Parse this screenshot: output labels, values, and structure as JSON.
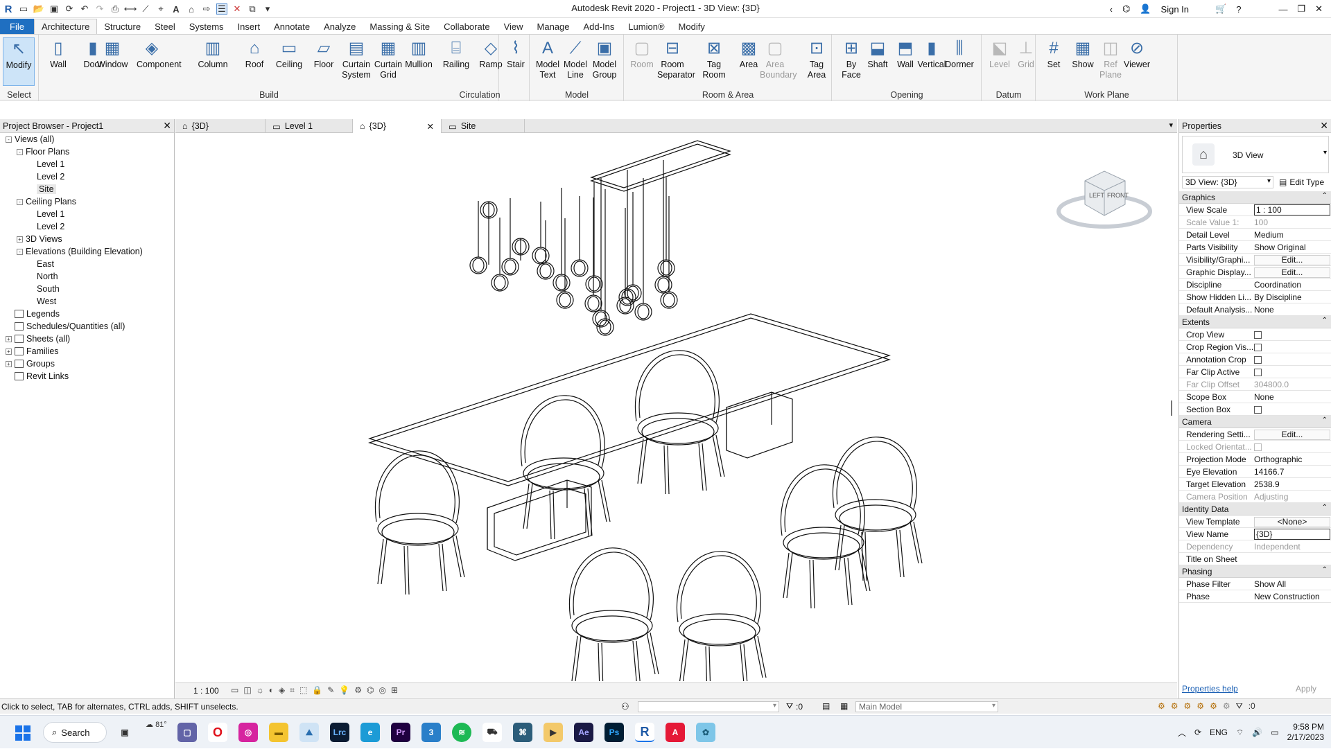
{
  "window": {
    "title": "Autodesk Revit 2020 - Project1 - 3D View: {3D}",
    "sign_in": "Sign In"
  },
  "menu": [
    "File",
    "Architecture",
    "Structure",
    "Steel",
    "Systems",
    "Insert",
    "Annotate",
    "Analyze",
    "Massing & Site",
    "Collaborate",
    "View",
    "Manage",
    "Add-Ins",
    "Lumion®",
    "Modify"
  ],
  "ribbon": {
    "select_label": "Select",
    "select_tools": [
      {
        "label": "Modify"
      }
    ],
    "build_label": "Build",
    "build_tools": [
      {
        "label": "Wall"
      },
      {
        "label": "Door"
      },
      {
        "label": "Window"
      },
      {
        "label": "Component"
      },
      {
        "label": "Column"
      },
      {
        "label": "Roof"
      },
      {
        "label": "Ceiling"
      },
      {
        "label": "Floor"
      },
      {
        "label": "Curtain\nSystem"
      },
      {
        "label": "Curtain\nGrid"
      },
      {
        "label": "Mullion"
      }
    ],
    "circulation_label": "Circulation",
    "circulation_tools": [
      {
        "label": "Railing"
      },
      {
        "label": "Ramp"
      },
      {
        "label": "Stair"
      }
    ],
    "model_label": "Model",
    "model_tools": [
      {
        "label": "Model\nText"
      },
      {
        "label": "Model\nLine"
      },
      {
        "label": "Model\nGroup"
      }
    ],
    "room_label": "Room & Area",
    "room_tools": [
      {
        "label": "Room",
        "disabled": true
      },
      {
        "label": "Room\nSeparator"
      },
      {
        "label": "Tag\nRoom"
      },
      {
        "label": "Area"
      },
      {
        "label": "Area\nBoundary",
        "disabled": true
      },
      {
        "label": "Tag\nArea"
      }
    ],
    "opening_label": "Opening",
    "opening_tools": [
      {
        "label": "By\nFace"
      },
      {
        "label": "Shaft"
      },
      {
        "label": "Wall"
      },
      {
        "label": "Vertical"
      },
      {
        "label": "Dormer"
      }
    ],
    "datum_label": "Datum",
    "datum_tools": [
      {
        "label": "Level",
        "disabled": true
      },
      {
        "label": "Grid",
        "disabled": true
      }
    ],
    "workplane_label": "Work Plane",
    "workplane_tools": [
      {
        "label": "Set"
      },
      {
        "label": "Show"
      },
      {
        "label": "Ref\nPlane",
        "disabled": true
      },
      {
        "label": "Viewer"
      }
    ]
  },
  "browser": {
    "title": "Project Browser - Project1",
    "nodes": [
      {
        "label": "Views (all)",
        "level": 0,
        "exp": "-"
      },
      {
        "label": "Floor Plans",
        "level": 1,
        "exp": "-"
      },
      {
        "label": "Level 1",
        "level": 2
      },
      {
        "label": "Level 2",
        "level": 2
      },
      {
        "label": "Site",
        "level": 2,
        "selected": true
      },
      {
        "label": "Ceiling Plans",
        "level": 1,
        "exp": "-"
      },
      {
        "label": "Level 1",
        "level": 2
      },
      {
        "label": "Level 2",
        "level": 2
      },
      {
        "label": "3D Views",
        "level": 1,
        "exp": "+"
      },
      {
        "label": "Elevations (Building Elevation)",
        "level": 1,
        "exp": "-"
      },
      {
        "label": "East",
        "level": 2
      },
      {
        "label": "North",
        "level": 2
      },
      {
        "label": "South",
        "level": 2
      },
      {
        "label": "West",
        "level": 2
      },
      {
        "label": "Legends",
        "level": 0,
        "icon": true
      },
      {
        "label": "Schedules/Quantities (all)",
        "level": 0,
        "icon": true
      },
      {
        "label": "Sheets (all)",
        "level": 0,
        "exp": "+",
        "icon": true
      },
      {
        "label": "Families",
        "level": 0,
        "exp": "+",
        "icon": true
      },
      {
        "label": "Groups",
        "level": 0,
        "exp": "+",
        "icon": true
      },
      {
        "label": "Revit Links",
        "level": 0,
        "icon": true
      }
    ]
  },
  "tabs": [
    {
      "label": "{3D}",
      "active": false
    },
    {
      "label": "Level 1",
      "active": false
    },
    {
      "label": "{3D}",
      "active": true
    },
    {
      "label": "Site",
      "active": false
    }
  ],
  "viewcube": {
    "left": "LEFT",
    "front": "FRONT"
  },
  "viewbar": {
    "scale": "1 : 100"
  },
  "properties": {
    "title": "Properties",
    "type_name": "3D View",
    "selector": "3D View: {3D}",
    "edit_type": "Edit Type",
    "help": "Properties help",
    "apply": "Apply",
    "sections": [
      {
        "name": "Graphics",
        "rows": [
          {
            "k": "View Scale",
            "v": "1 : 100",
            "input": true
          },
          {
            "k": "Scale Value    1:",
            "v": "100",
            "dis": true
          },
          {
            "k": "Detail Level",
            "v": "Medium"
          },
          {
            "k": "Parts Visibility",
            "v": "Show Original"
          },
          {
            "k": "Visibility/Graphi...",
            "v": "Edit...",
            "btn": true
          },
          {
            "k": "Graphic Display...",
            "v": "Edit...",
            "btn": true
          },
          {
            "k": "Discipline",
            "v": "Coordination"
          },
          {
            "k": "Show Hidden Li...",
            "v": "By Discipline"
          },
          {
            "k": "Default Analysis...",
            "v": "None"
          }
        ]
      },
      {
        "name": "Extents",
        "rows": [
          {
            "k": "Crop View",
            "v": "",
            "chk": true
          },
          {
            "k": "Crop Region Vis...",
            "v": "",
            "chk": true
          },
          {
            "k": "Annotation Crop",
            "v": "",
            "chk": true
          },
          {
            "k": "Far Clip Active",
            "v": "",
            "chk": true
          },
          {
            "k": "Far Clip Offset",
            "v": "304800.0",
            "dis": true
          },
          {
            "k": "Scope Box",
            "v": "None"
          },
          {
            "k": "Section Box",
            "v": "",
            "chk": true
          }
        ]
      },
      {
        "name": "Camera",
        "rows": [
          {
            "k": "Rendering Setti...",
            "v": "Edit...",
            "btn": true
          },
          {
            "k": "Locked Orientat...",
            "v": "",
            "chk": true,
            "dis": true
          },
          {
            "k": "Projection Mode",
            "v": "Orthographic"
          },
          {
            "k": "Eye Elevation",
            "v": "14166.7"
          },
          {
            "k": "Target Elevation",
            "v": "2538.9"
          },
          {
            "k": "Camera Position",
            "v": "Adjusting",
            "dis": true
          }
        ]
      },
      {
        "name": "Identity Data",
        "rows": [
          {
            "k": "View Template",
            "v": "<None>",
            "btn": true
          },
          {
            "k": "View Name",
            "v": "{3D}",
            "input": true
          },
          {
            "k": "Dependency",
            "v": "Independent",
            "dis": true
          },
          {
            "k": "Title on Sheet",
            "v": ""
          }
        ]
      },
      {
        "name": "Phasing",
        "rows": [
          {
            "k": "Phase Filter",
            "v": "Show All"
          },
          {
            "k": "Phase",
            "v": "New Construction"
          }
        ]
      }
    ]
  },
  "status": {
    "hint": "Click to select, TAB for alternates, CTRL adds, SHIFT unselects.",
    "sel_count": ":0",
    "model": "Main Model",
    "filter_count": ":0"
  },
  "taskbar": {
    "search": "Search",
    "weather": "81°",
    "lang": "ENG",
    "time": "9:58 PM",
    "date": "2/17/2023"
  }
}
